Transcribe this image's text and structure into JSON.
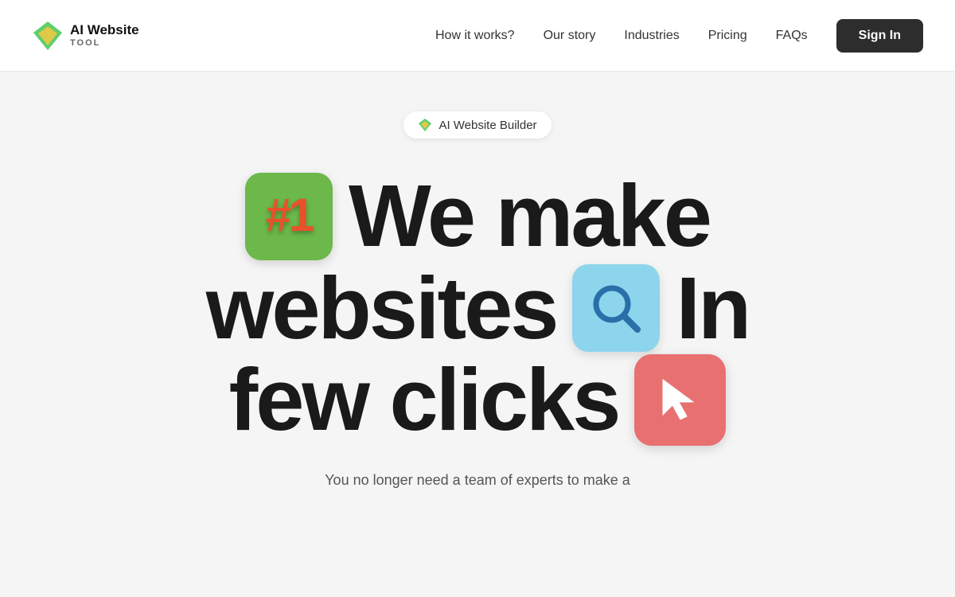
{
  "header": {
    "logo": {
      "text_ai": "AI",
      "text_website": "Website",
      "text_tool": "TOOL"
    },
    "nav": {
      "items": [
        {
          "label": "How it works?",
          "id": "how-it-works"
        },
        {
          "label": "Our story",
          "id": "our-story"
        },
        {
          "label": "Industries",
          "id": "industries"
        },
        {
          "label": "Pricing",
          "id": "pricing"
        },
        {
          "label": "FAQs",
          "id": "faqs"
        }
      ],
      "cta": "Sign In"
    }
  },
  "hero": {
    "badge": "AI Website Builder",
    "heading_line1_text": "We make",
    "heading_line2_pre": "websites",
    "heading_line2_post": "In",
    "heading_line3_pre": "few clicks",
    "sub_text": "You no longer need a team of experts to make a"
  }
}
